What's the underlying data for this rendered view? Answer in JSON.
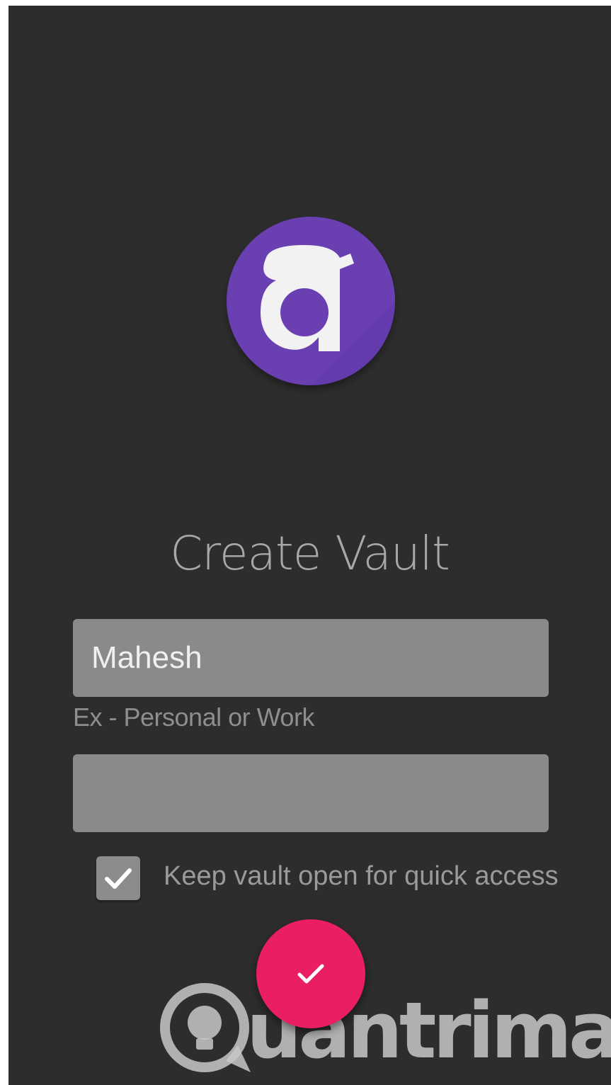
{
  "screen": {
    "title": "Create Vault",
    "vault_name_value": "Mahesh",
    "vault_name_hint": "Ex - Personal or Work",
    "password_value": "",
    "keep_open_label": "Keep vault open for quick access",
    "keep_open_checked": true
  },
  "icons": {
    "logo": "app-logo-a",
    "checkbox": "check-icon",
    "submit": "check-icon"
  },
  "watermark": {
    "text": "uantrimang"
  },
  "colors": {
    "background": "#2d2d2d",
    "logo": "#6a3fb2",
    "fab": "#e91e63",
    "field": "#8a8a8a"
  }
}
